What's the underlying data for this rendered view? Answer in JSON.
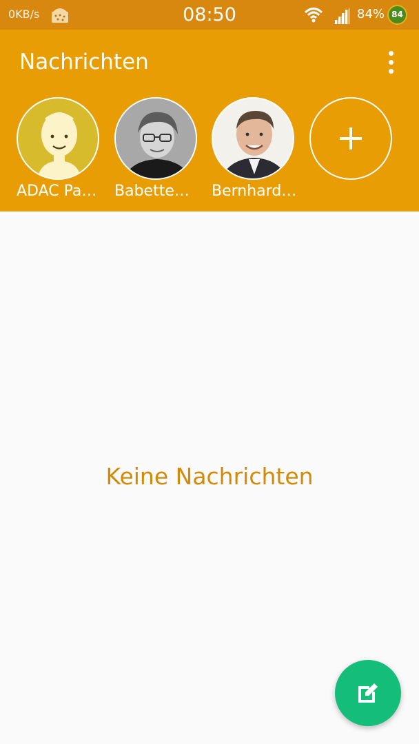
{
  "status_bar": {
    "network_speed": "0KB/s",
    "time": "08:50",
    "battery_percent": "84%",
    "battery_badge": "84"
  },
  "app_bar": {
    "title": "Nachrichten",
    "menu_icon": "more-vert-icon"
  },
  "favorites": [
    {
      "name": "ADAC Pa…",
      "avatar": "default-person-avatar"
    },
    {
      "name": "Babette…",
      "avatar": "photo-avatar"
    },
    {
      "name": "Bernhard…",
      "avatar": "photo-avatar"
    }
  ],
  "add_contact_icon": "plus-icon",
  "empty_state": "Keine Nachrichten",
  "fab_icon": "compose-icon",
  "colors": {
    "status_bar": "#d8870f",
    "app_bar": "#e89d04",
    "accent_text": "#d38a07",
    "fab": "#15bd7b",
    "background": "#fafafa"
  }
}
